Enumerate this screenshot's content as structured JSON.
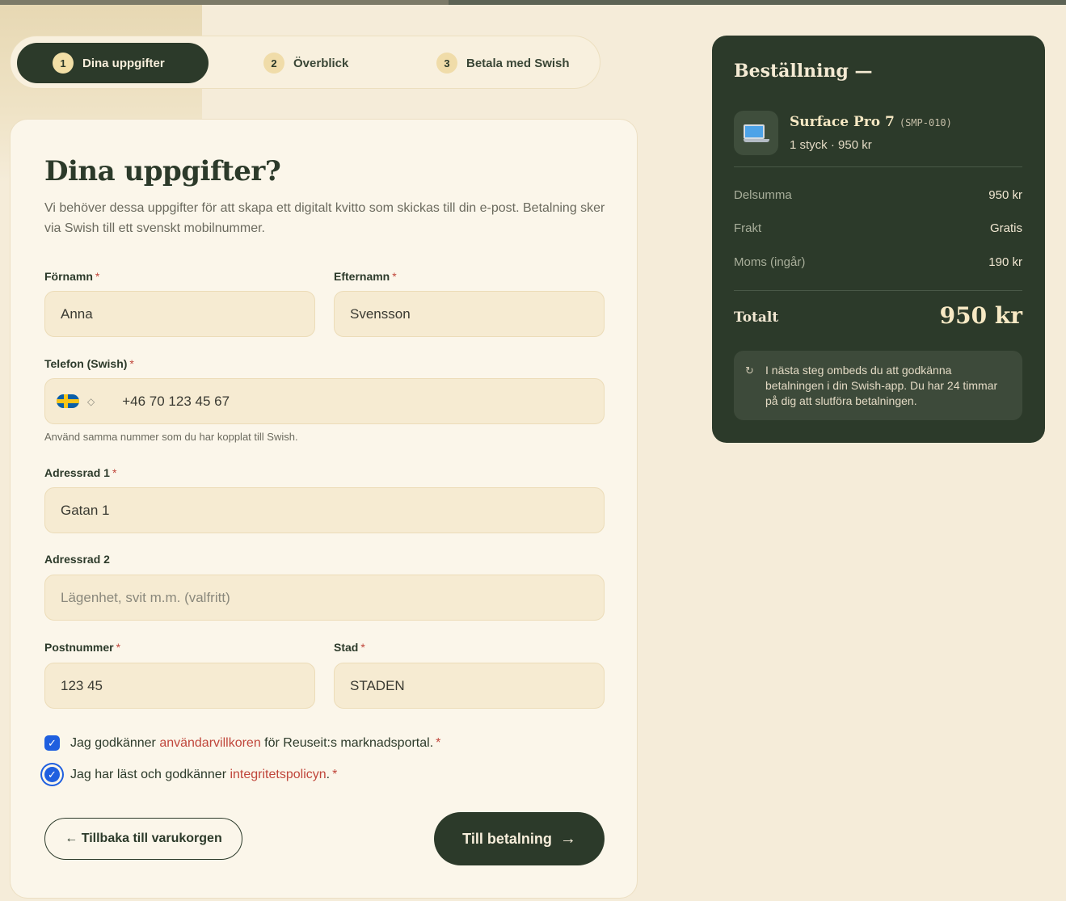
{
  "stepper": {
    "steps": [
      {
        "num": "1",
        "label": "Dina uppgifter"
      },
      {
        "num": "2",
        "label": "Överblick"
      },
      {
        "num": "3",
        "label": "Betala med Swish"
      }
    ]
  },
  "form": {
    "title": "Dina uppgifter?",
    "intro": "Vi behöver dessa uppgifter för att skapa ett digitalt kvitto som skickas till din e-post. Betalning sker via Swish till ett svenskt mobilnummer.",
    "required_mark": "*",
    "first_name": {
      "label": "Förnamn",
      "value": "Anna"
    },
    "last_name": {
      "label": "Efternamn",
      "value": "Svensson"
    },
    "phone": {
      "label": "Telefon (Swish)",
      "value": "+46 70 123 45 67",
      "hint": "Använd samma nummer som du har kopplat till Swish."
    },
    "address1": {
      "label": "Adressrad 1",
      "value": "Gatan 1"
    },
    "address2": {
      "label": "Adressrad 2",
      "placeholder": "Lägenhet, svit m.m. (valfritt)"
    },
    "postal": {
      "label": "Postnummer",
      "value": "123 45"
    },
    "city": {
      "label": "Stad",
      "value": "STADEN"
    },
    "terms": {
      "pre": "Jag godkänner ",
      "link": "användarvillkoren",
      "post": " för Reuseit:s marknadsportal.",
      "checked": true
    },
    "privacy": {
      "pre": "Jag har läst och godkänner ",
      "link": "integritetspolicyn",
      "post": ".",
      "checked": true
    },
    "back_label": "← Tillbaka till varukorgen",
    "next_label": "Till betalning",
    "next_arrow": "→"
  },
  "order": {
    "title": "Beställning —",
    "product": {
      "name": "Surface Pro 7",
      "sku": "(SMP-010)",
      "sub": "1 styck · 950 kr",
      "icon": "laptop-icon"
    },
    "rows": [
      {
        "k": "Delsumma",
        "v": "950 kr"
      },
      {
        "k": "Frakt",
        "v": "Gratis"
      },
      {
        "k": "Moms (ingår)",
        "v": "190 kr"
      }
    ],
    "total_label": "Totalt",
    "total_value": "950 kr",
    "note_icon": "↻",
    "note": "I nästa steg ombeds du att godkänna betalningen i din Swish-app. Du har 24 timmar på dig att slutföra betalningen."
  },
  "colors": {
    "accent": "#2c3a2a",
    "background": "#f5ecd9",
    "link": "#c0463b",
    "checkbox": "#1f5fdf"
  }
}
